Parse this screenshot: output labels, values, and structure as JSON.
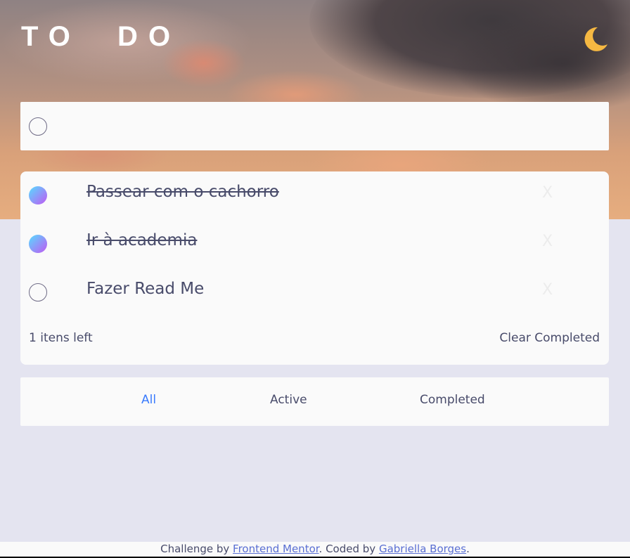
{
  "header": {
    "title": "TO  DO",
    "theme_icon": "moon-icon",
    "theme_icon_color": "#f5b842"
  },
  "new_todo": {
    "value": "",
    "placeholder": ""
  },
  "todos": [
    {
      "text": "Passear com o cachorro",
      "completed": true,
      "delete_label": "X"
    },
    {
      "text": "Ir à academia",
      "completed": true,
      "delete_label": "X"
    },
    {
      "text": "Fazer Read Me",
      "completed": false,
      "delete_label": "X"
    }
  ],
  "list_footer": {
    "items_left": "1 itens left",
    "clear_completed": "Clear Completed"
  },
  "filters": {
    "all": "All",
    "active": "Active",
    "completed": "Completed",
    "selected": "All"
  },
  "attribution": {
    "prefix": "Challenge by ",
    "link1": "Frontend Mentor",
    "middle": ". Coded by ",
    "link2": "Gabriella Borges",
    "suffix": "."
  },
  "colors": {
    "accent": "#3a7bfd",
    "check_gradient_start": "#57ddff",
    "check_gradient_end": "#c058f3",
    "page_background": "#e4e4f0",
    "card_background": "#fafafa"
  }
}
